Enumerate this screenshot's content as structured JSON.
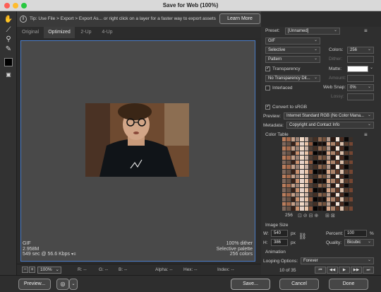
{
  "window": {
    "title": "Save for Web (100%)"
  },
  "tip": {
    "text": "Tip: Use File > Export > Export As... or right click on a layer for a faster way to export assets",
    "learn_more": "Learn More"
  },
  "tabs": [
    "Original",
    "Optimized",
    "2-Up",
    "4-Up"
  ],
  "active_tab": "Optimized",
  "info_left": {
    "format": "GIF",
    "size": "2.958M",
    "time": "549 sec @ 56.6 Kbps"
  },
  "info_right": {
    "dither": "100% dither",
    "palette": "Selective palette",
    "colors": "256 colors"
  },
  "status": {
    "zoom": "100%",
    "r": "R: --",
    "g": "G: --",
    "b": "B: --",
    "alpha": "Alpha: --",
    "hex": "Hex: --",
    "index": "Index: --"
  },
  "bottom": {
    "preview": "Preview...",
    "save": "Save...",
    "cancel": "Cancel",
    "done": "Done"
  },
  "panel": {
    "preset_label": "Preset:",
    "preset_value": "[Unnamed]",
    "format": "GIF",
    "reduction": "Selective",
    "colors_label": "Colors:",
    "colors_value": "256",
    "dither_algo": "Pattern",
    "dither_label": "Dither:",
    "transparency": "Transparency",
    "matte_label": "Matte:",
    "transparency_dither": "No Transparency Dit...",
    "amount_label": "Amount:",
    "interlaced": "Interlaced",
    "websnap_label": "Web Snap:",
    "websnap_value": "0%",
    "lossy_label": "Lossy:",
    "convert_srgb": "Convert to sRGB",
    "preview_label": "Preview:",
    "preview_value": "Internet Standard RGB (No Color Mana...",
    "metadata_label": "Metadata:",
    "metadata_value": "Copyright and Contact Info",
    "color_table_label": "Color Table",
    "color_count": "256",
    "image_size_label": "Image Size",
    "w_label": "W:",
    "w_value": "540",
    "h_label": "H:",
    "h_value": "386",
    "px": "px",
    "percent_label": "Percent:",
    "percent_value": "100",
    "percent_unit": "%",
    "quality_label": "Quality:",
    "quality_value": "Bicubic",
    "animation_label": "Animation",
    "looping_label": "Looping Options:",
    "looping_value": "Forever",
    "frame_counter": "10 of 35"
  },
  "colors": {
    "accent": "#4b7cc6",
    "matte": "#ffffff"
  }
}
